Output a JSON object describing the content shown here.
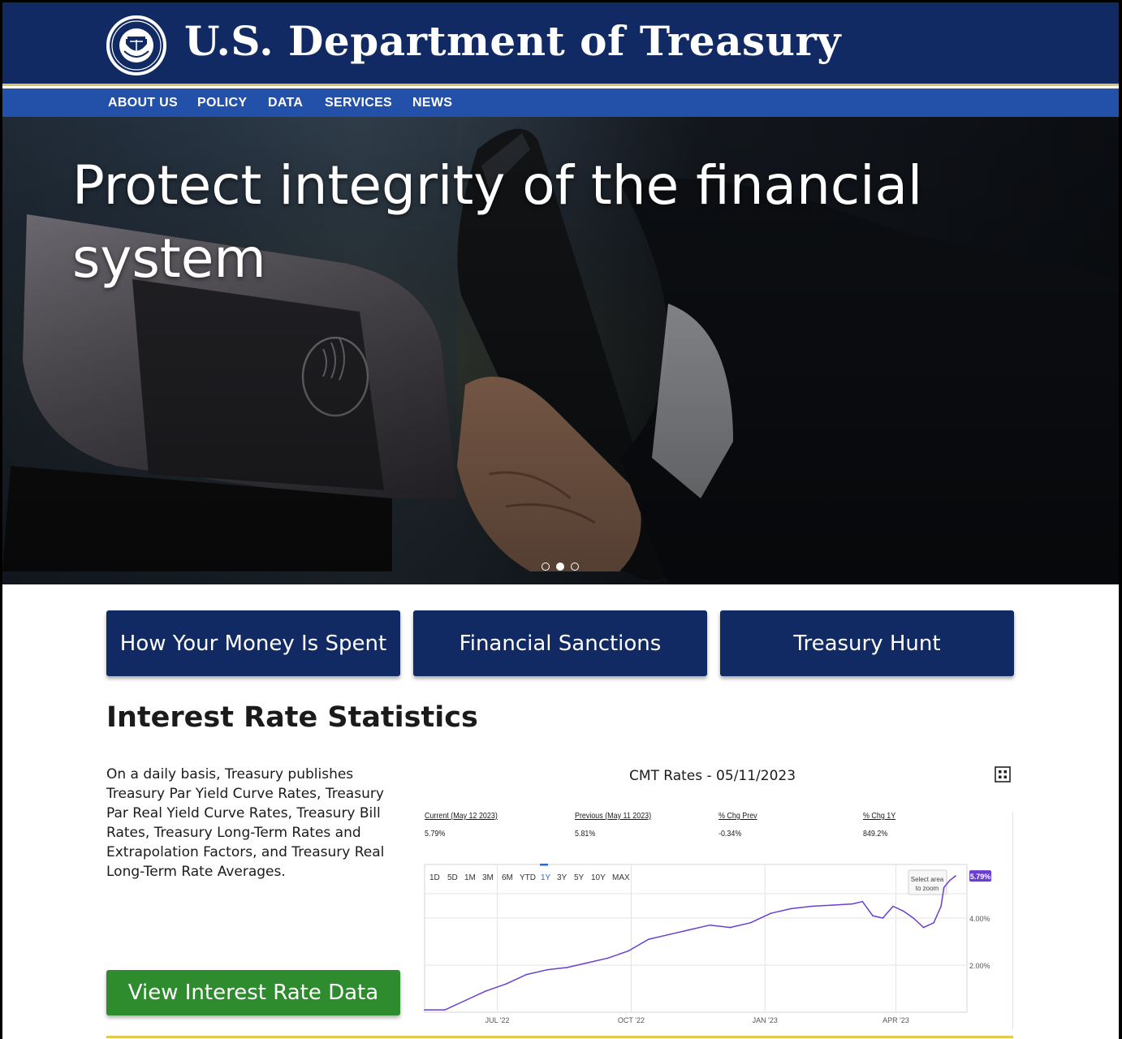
{
  "header": {
    "title": "U.S. Department of Treasury",
    "seal_icon": "treasury-seal-icon"
  },
  "nav": {
    "items": [
      {
        "label": "ABOUT US"
      },
      {
        "label": "POLICY"
      },
      {
        "label": "DATA"
      },
      {
        "label": "SERVICES"
      },
      {
        "label": "NEWS"
      }
    ]
  },
  "hero": {
    "title": "Protect integrity of the financial system",
    "slides_total": 3,
    "active_slide": 2
  },
  "quick_links": [
    {
      "label": "How Your Money Is Spent"
    },
    {
      "label": "Financial Sanctions"
    },
    {
      "label": "Treasury Hunt"
    }
  ],
  "interest_section": {
    "title": "Interest Rate Statistics",
    "description": "On a daily basis, Treasury publishes Treasury Par Yield Curve Rates, Treasury Par Real Yield Curve Rates, Treasury Bill Rates, Treasury Long-Term Rates and Extrapolation Factors, and Treasury Real Long-Term Rate Averages.",
    "button_label": "View Interest Rate Data"
  },
  "chart_widget": {
    "title": "CMT Rates - 05/11/2023",
    "stats": [
      {
        "label": "Current (May 12 2023)",
        "value": "5.79%"
      },
      {
        "label": "Previous (May 11 2023)",
        "value": "5.81%"
      },
      {
        "label": "% Chg Prev",
        "value": "-0.34%"
      },
      {
        "label": "% Chg 1Y",
        "value": "849.2%"
      }
    ],
    "ranges": [
      "1D",
      "5D",
      "1M",
      "3M",
      "6M",
      "YTD",
      "1Y",
      "3Y",
      "5Y",
      "10Y",
      "MAX"
    ],
    "active_range": "1Y",
    "zoom_hint_line1": "Select area",
    "zoom_hint_line2": "to zoom",
    "current_badge": "5.79%",
    "accent_color": "#6a3fd0"
  },
  "chart_data": {
    "type": "line",
    "title": "CMT Rates - 05/11/2023",
    "x_tick_labels": [
      "JUL '22",
      "OCT '22",
      "JAN '23",
      "APR '23"
    ],
    "y_tick_labels": [
      "2.00%",
      "4.00%"
    ],
    "ylim": [
      0.0,
      6.0
    ],
    "grid": true,
    "series": [
      {
        "x": [
          "2022-05-12",
          "2022-05-26",
          "2022-06-09",
          "2022-06-23",
          "2022-07-07",
          "2022-07-21",
          "2022-08-04",
          "2022-08-18",
          "2022-09-01",
          "2022-09-15",
          "2022-09-29",
          "2022-10-13",
          "2022-10-27",
          "2022-11-10",
          "2022-11-24",
          "2022-12-08",
          "2022-12-22",
          "2023-01-05",
          "2023-01-19",
          "2023-02-02",
          "2023-02-16",
          "2023-03-02",
          "2023-03-09",
          "2023-03-16",
          "2023-03-23",
          "2023-03-30",
          "2023-04-06",
          "2023-04-13",
          "2023-04-20",
          "2023-04-27",
          "2023-05-02",
          "2023-05-04",
          "2023-05-08",
          "2023-05-12"
        ],
        "values": [
          0.1,
          0.1,
          0.5,
          0.9,
          1.2,
          1.6,
          1.8,
          1.9,
          2.1,
          2.3,
          2.6,
          3.1,
          3.3,
          3.5,
          3.7,
          3.6,
          3.8,
          4.2,
          4.4,
          4.5,
          4.55,
          4.6,
          4.7,
          4.1,
          4.0,
          4.5,
          4.3,
          4.0,
          3.6,
          3.8,
          4.5,
          5.3,
          5.6,
          5.79
        ]
      }
    ]
  }
}
